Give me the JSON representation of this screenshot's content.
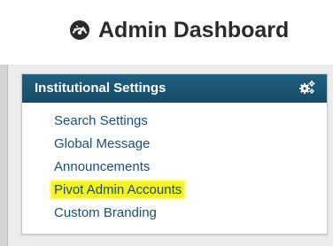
{
  "header": {
    "title": "Admin Dashboard",
    "icon": "tachometer-icon"
  },
  "panel": {
    "title": "Institutional Settings",
    "icon": "gears-icon",
    "items": [
      {
        "label": "Search Settings",
        "highlighted": false
      },
      {
        "label": "Global Message",
        "highlighted": false
      },
      {
        "label": "Announcements",
        "highlighted": false
      },
      {
        "label": "Pivot Admin Accounts",
        "highlighted": true
      },
      {
        "label": "Custom Branding",
        "highlighted": false
      }
    ]
  },
  "colors": {
    "panel_header": "#1f5f80",
    "link": "#1a4f73",
    "highlight": "#f6f321",
    "title_text": "#2b2b2b"
  }
}
